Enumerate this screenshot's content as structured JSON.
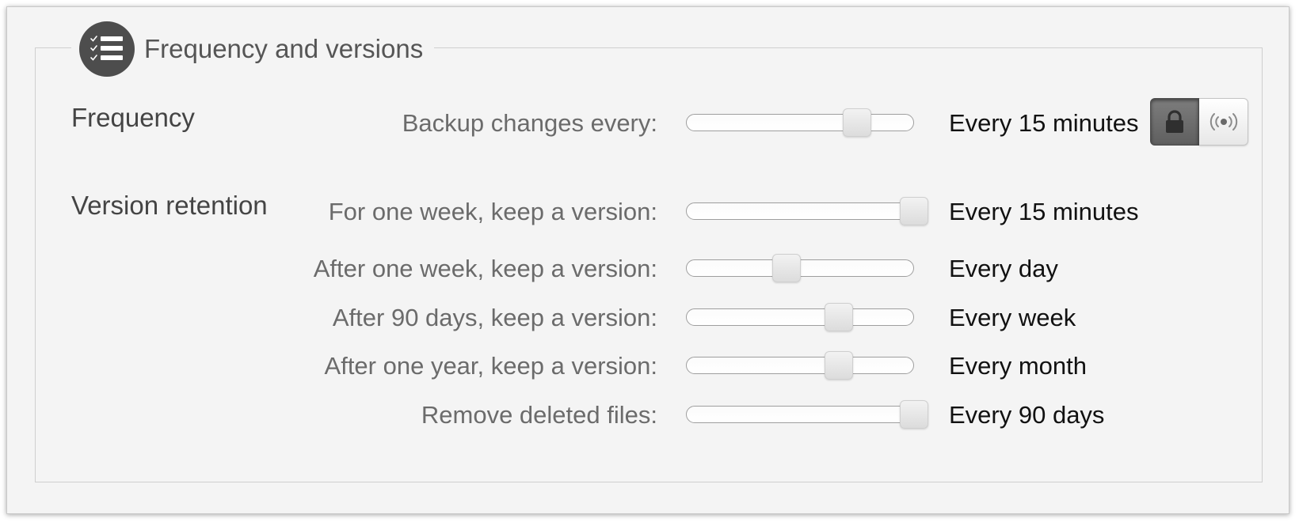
{
  "group": {
    "title": "Frequency and versions",
    "icon": "checklist-icon"
  },
  "sections": {
    "frequency_label": "Frequency",
    "retention_label": "Version retention"
  },
  "rows": [
    {
      "id": "backup",
      "label": "Backup changes every:",
      "value": "Every 15 minutes",
      "slider_fraction": 0.75
    },
    {
      "id": "week",
      "label": "For one week, keep a version:",
      "value": "Every 15 minutes",
      "slider_fraction": 1.0
    },
    {
      "id": "after-week",
      "label": "After one week, keep a version:",
      "value": "Every day",
      "slider_fraction": 0.44
    },
    {
      "id": "after-90",
      "label": "After 90 days, keep a version:",
      "value": "Every week",
      "slider_fraction": 0.67
    },
    {
      "id": "after-year",
      "label": "After one year, keep a version:",
      "value": "Every month",
      "slider_fraction": 0.67
    },
    {
      "id": "deleted",
      "label": "Remove deleted files:",
      "value": "Every 90 days",
      "slider_fraction": 1.0
    }
  ],
  "mode_buttons": {
    "lock": {
      "icon": "lock-icon",
      "selected": true
    },
    "live": {
      "icon": "broadcast-icon",
      "selected": false
    }
  },
  "colors": {
    "icon_circle": "#4d4d4d",
    "selected_button": "#6a6a6a"
  }
}
